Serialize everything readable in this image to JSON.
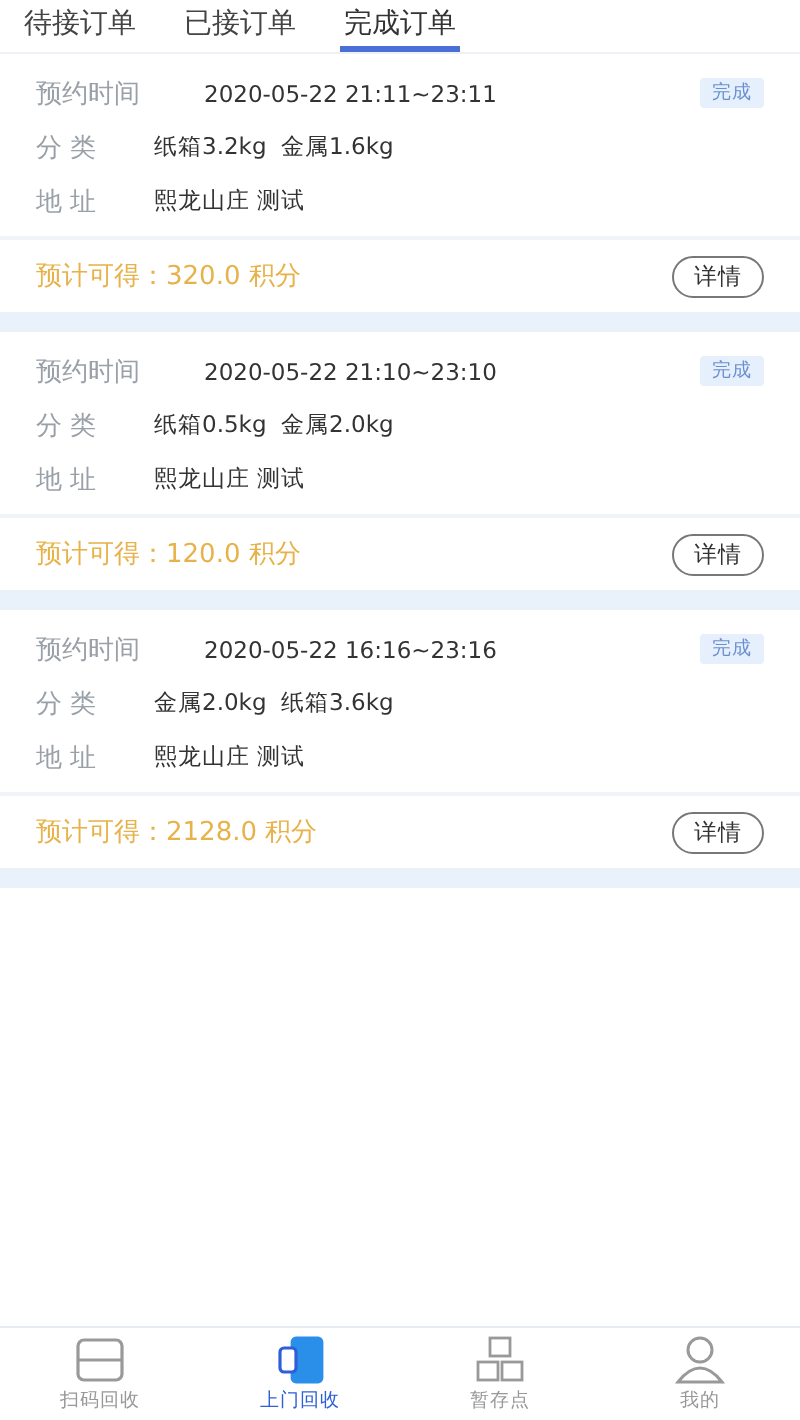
{
  "tabs": [
    {
      "label": "待接订单",
      "selected": false
    },
    {
      "label": "已接订单",
      "selected": false
    },
    {
      "label": "完成订单",
      "selected": true
    }
  ],
  "orders": [
    {
      "time_label": "预约时间",
      "time": "2020-05-22 21:11~23:11",
      "status": "完成",
      "category_label": "分 类",
      "category": "纸箱3.2kg  金属1.6kg",
      "address_label": "地 址",
      "address": "熙龙山庄 测试",
      "points": "预计可得：320.0 积分",
      "button": "详情"
    },
    {
      "time_label": "预约时间",
      "time": "2020-05-22 21:10~23:10",
      "status": "完成",
      "category_label": "分 类",
      "category": "纸箱0.5kg  金属2.0kg",
      "address_label": "地 址",
      "address": "熙龙山庄 测试",
      "points": "预计可得：120.0 积分",
      "button": "详情"
    },
    {
      "time_label": "预约时间",
      "time": "2020-05-22 16:16~23:16",
      "status": "完成",
      "category_label": "分 类",
      "category": "金属2.0kg  纸箱3.6kg",
      "address_label": "地 址",
      "address": "熙龙山庄 测试",
      "points": "预计可得：2128.0 积分",
      "button": "详情"
    }
  ],
  "nav": [
    {
      "kind": "scan",
      "label": "扫码回收",
      "selected": false
    },
    {
      "kind": "door",
      "label": "上门回收",
      "selected": true
    },
    {
      "kind": "store",
      "label": "暂存点",
      "selected": false
    },
    {
      "kind": "me",
      "label": "我的",
      "selected": false
    }
  ]
}
